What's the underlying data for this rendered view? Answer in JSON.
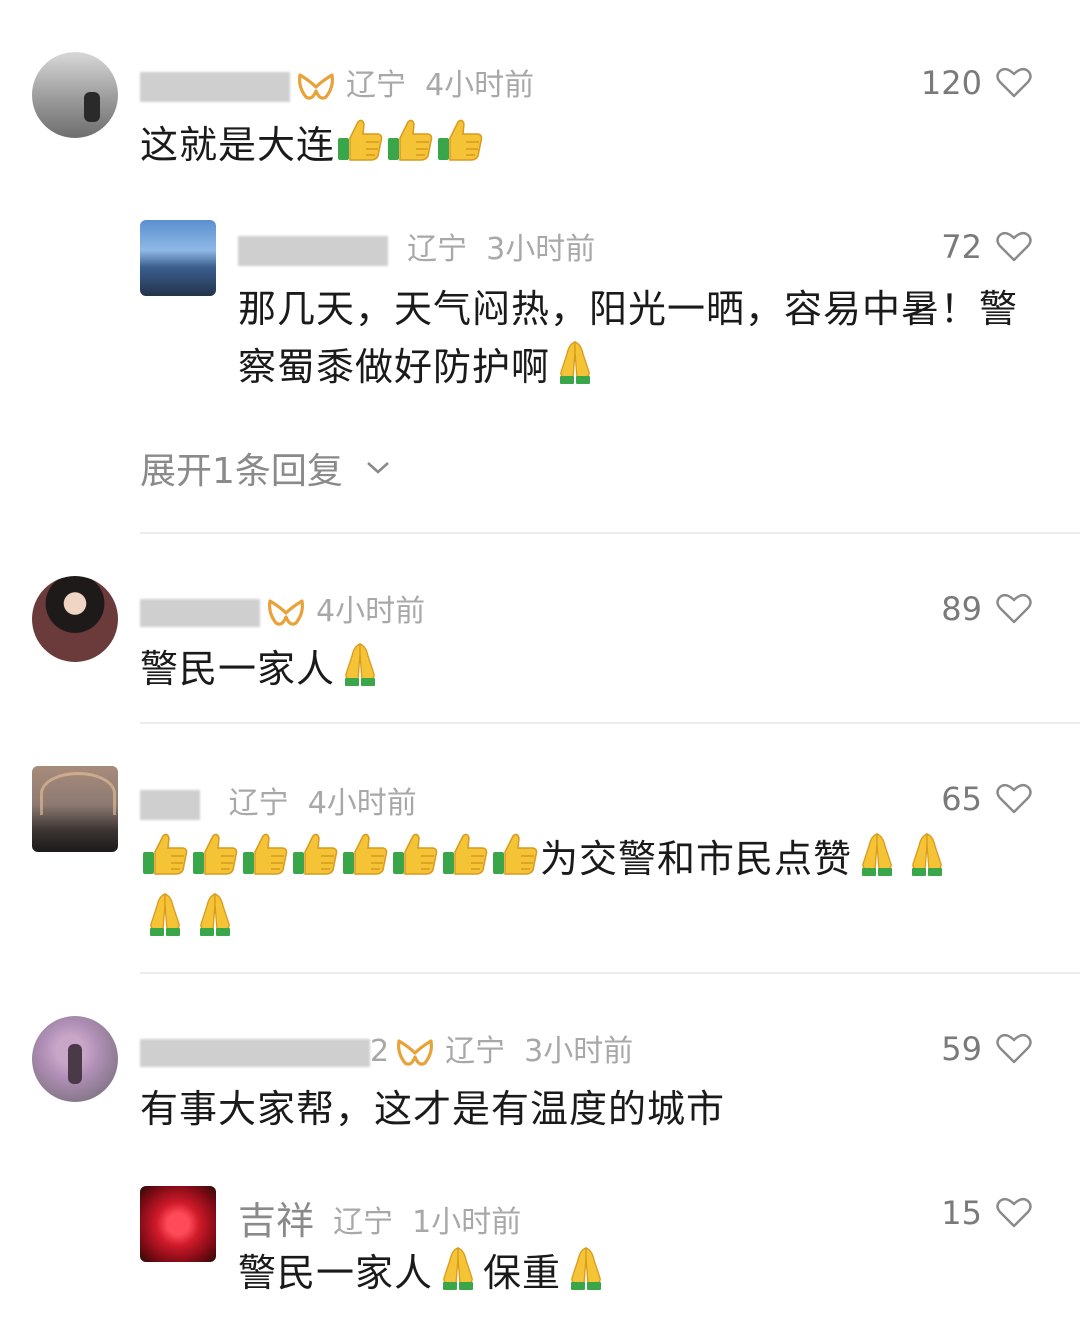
{
  "comments": [
    {
      "name": "",
      "location": "辽宁",
      "time": "4小时前",
      "likes": "120",
      "text": "这就是大连",
      "reply": {
        "name": "",
        "location": "辽宁",
        "time": "3小时前",
        "likes": "72",
        "text_line1": "那几天，天气闷热，阳光一晒，容易中暑！警",
        "text_line2": "察蜀黍做好防护啊"
      },
      "expand_label": "展开1条回复"
    },
    {
      "name": "",
      "location": "",
      "time": "4小时前",
      "likes": "89",
      "text": "警民一家人"
    },
    {
      "name": "",
      "location": "辽宁",
      "time": "4小时前",
      "likes": "65",
      "text": "为交警和市民点赞"
    },
    {
      "name": "2",
      "location": "辽宁",
      "time": "3小时前",
      "likes": "59",
      "text": "有事大家帮，这才是有温度的城市",
      "reply": {
        "name": "吉祥",
        "location": "辽宁",
        "time": "1小时前",
        "likes": "15",
        "text_a": "警民一家人",
        "text_b": "保重"
      }
    }
  ],
  "icons": {
    "like": "heart-outline-icon",
    "vip": "vip-badge-icon",
    "thumbs": "thumbs-up-emoji",
    "pray": "folded-hands-emoji",
    "expand": "chevron-down-icon"
  },
  "colors": {
    "text": "#1a1a1a",
    "meta": "#a8a8a8",
    "vip": "#e8a23a",
    "divider": "#ececec"
  }
}
